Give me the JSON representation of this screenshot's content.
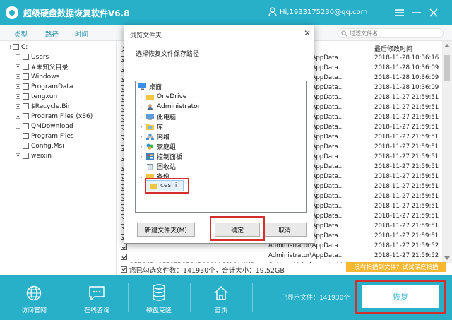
{
  "app": {
    "title": "超级硬盘数据恢复软件V6.8",
    "user": "Hi,1933175230@qq.com"
  },
  "tabs": [
    {
      "label": "类型"
    },
    {
      "label": "路径"
    },
    {
      "label": "时间"
    }
  ],
  "search": {
    "placeholder": "过滤文件名"
  },
  "tree": {
    "root": "C:",
    "items": [
      "Users",
      "#未知父目录",
      "Windows",
      "ProgramData",
      "tengxun",
      "$Recycle.Bin",
      "Program Files (x86)",
      "QMDownload",
      "Program Files",
      "Config.Msi",
      "weixin"
    ]
  },
  "table": {
    "header_name": "文",
    "header_time": "最后修改时间",
    "rows": [
      {
        "name": "",
        "size": "",
        "path": "Administrator\\AppData...",
        "time": "2018-11-28 10:36:16"
      },
      {
        "name": "",
        "size": "",
        "path": "Administrator\\AppData...",
        "time": "2018-11-28 10:36:09"
      },
      {
        "name": "",
        "size": "",
        "path": "Administrator\\AppData...",
        "time": "2018-11-28 10:36:09"
      },
      {
        "name": "",
        "size": "",
        "path": "Administrator\\AppData...",
        "time": "2018-11-28 10:36:09"
      },
      {
        "name": "",
        "size": "",
        "path": "Administrator\\AppData...",
        "time": "2018-11-27 21:59:51"
      },
      {
        "name": "",
        "size": "",
        "path": "Administrator\\AppData...",
        "time": "2018-11-27 21:59:51"
      },
      {
        "name": "",
        "size": "",
        "path": "Administrator\\AppData...",
        "time": "2018-11-27 21:59:51"
      },
      {
        "name": "",
        "size": "",
        "path": "Administrator\\AppData...",
        "time": "2018-11-27 21:59:51"
      },
      {
        "name": "",
        "size": "",
        "path": "Administrator\\AppData...",
        "time": "2018-11-27 21:59:51"
      },
      {
        "name": "",
        "size": "",
        "path": "Administrator\\AppData...",
        "time": "2018-11-27 21:59:51"
      },
      {
        "name": "",
        "size": "",
        "path": "Administrator\\AppData...",
        "time": "2018-11-27 21:59:51"
      },
      {
        "name": "",
        "size": "",
        "path": "Administrator\\AppData...",
        "time": "2018-11-27 21:59:51"
      },
      {
        "name": "",
        "size": "",
        "path": "Administrator\\AppData...",
        "time": "2018-11-27 21:59:51"
      },
      {
        "name": "",
        "size": "",
        "path": "Administrator\\AppData...",
        "time": "2018-11-27 21:59:51"
      },
      {
        "name": "",
        "size": "",
        "path": "Administrator\\AppData...",
        "time": "2018-11-27 21:59:51"
      },
      {
        "name": "",
        "size": "",
        "path": "Administrator\\AppData...",
        "time": "2018-11-27 21:59:51"
      },
      {
        "name": "",
        "size": "",
        "path": "Administrator\\AppData...",
        "time": "2018-11-27 21:59:51"
      },
      {
        "name": "",
        "size": "",
        "path": "Administrator\\AppData...",
        "time": "2018-11-27 21:59:51"
      },
      {
        "name": "",
        "size": "",
        "path": "Administrator\\AppData...",
        "time": "2018-11-27 21:59:51"
      },
      {
        "name": "",
        "size": "",
        "path": "Administrator\\AppData...",
        "time": "2018-11-27 21:59:52"
      },
      {
        "name": "",
        "size": "",
        "path": "Administrator\\AppData...",
        "time": "2018-11-27 21:59:52"
      },
      {
        "name": "25B6CD41FE675C5C4B6C61AC8...",
        "size": "164.8KB",
        "path": "C:\\Users\\Administrator\\AppData...",
        "time": "2018-11-27 21:59:52"
      }
    ]
  },
  "summary": {
    "text": "您已勾选文件数：141930个，合计大小：19.52GB",
    "notice": "没有扫描到文件？试试深度扫描"
  },
  "footer": {
    "visit_site": "访问官网",
    "online_help": "在线咨询",
    "disk_clone": "磁盘克隆",
    "home": "首页",
    "shown_count": "已显示文件：141930个",
    "recover": "恢复"
  },
  "dialog": {
    "title": "浏览文件夹",
    "prompt": "选择恢复文件保存路径",
    "folders": [
      {
        "label": "桌面",
        "icon": "desktop-icon"
      },
      {
        "label": "OneDrive",
        "icon": "folder-icon"
      },
      {
        "label": "Administrator",
        "icon": "user-icon"
      },
      {
        "label": "此电脑",
        "icon": "computer-icon"
      },
      {
        "label": "库",
        "icon": "library-icon"
      },
      {
        "label": "网络",
        "icon": "network-icon"
      },
      {
        "label": "家庭组",
        "icon": "homegroup-icon"
      },
      {
        "label": "控制面板",
        "icon": "control-panel-icon"
      },
      {
        "label": "回收站",
        "icon": "recycle-bin-icon"
      },
      {
        "label": "备份",
        "icon": "folder-icon"
      },
      {
        "label": "ceshi",
        "icon": "folder-icon"
      }
    ],
    "new_folder": "新建文件夹(M)",
    "ok": "确定",
    "cancel": "取消"
  },
  "colors": {
    "accent": "#28b0c9",
    "highlight": "#d32f2f",
    "notice": "#f7b731"
  }
}
